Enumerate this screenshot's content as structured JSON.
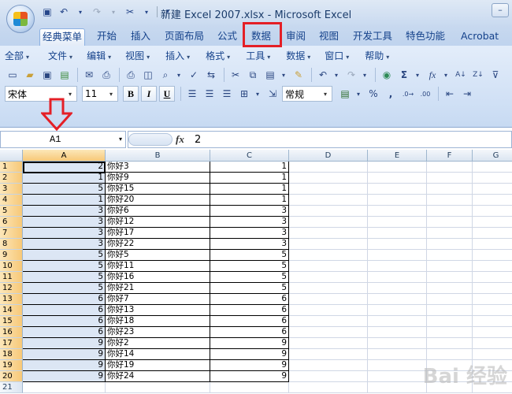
{
  "window": {
    "title": "新建 Excel 2007.xlsx - Microsoft Excel"
  },
  "quick_access": [
    "save-icon",
    "undo-icon",
    "redo-icon",
    "customize-icon"
  ],
  "ribbon_tabs": [
    {
      "label": "经典菜单",
      "active": true
    },
    {
      "label": "开始"
    },
    {
      "label": "插入"
    },
    {
      "label": "页面布局"
    },
    {
      "label": "公式"
    },
    {
      "label": "数据",
      "highlighted": true
    },
    {
      "label": "审阅"
    },
    {
      "label": "视图"
    },
    {
      "label": "开发工具"
    },
    {
      "label": "特色功能"
    },
    {
      "label": "Acrobat"
    }
  ],
  "menus": [
    "全部",
    "文件",
    "编辑",
    "视图",
    "插入",
    "格式",
    "工具",
    "数据",
    "窗口",
    "帮助"
  ],
  "format_bar": {
    "font": "宋体",
    "size": "11",
    "number_format": "常规",
    "bold": "B",
    "italic": "I",
    "underline": "U"
  },
  "formula_bar": {
    "name_box": "A1",
    "fx": "fx",
    "value": "2"
  },
  "columns": [
    "A",
    "B",
    "C",
    "D",
    "E",
    "F",
    "G"
  ],
  "rows": [
    {
      "n": "1",
      "a": "2",
      "b": "你好3",
      "c": "1"
    },
    {
      "n": "2",
      "a": "1",
      "b": "你好9",
      "c": "1"
    },
    {
      "n": "3",
      "a": "5",
      "b": "你好15",
      "c": "1"
    },
    {
      "n": "4",
      "a": "1",
      "b": "你好20",
      "c": "1"
    },
    {
      "n": "5",
      "a": "3",
      "b": "你好6",
      "c": "3"
    },
    {
      "n": "6",
      "a": "3",
      "b": "你好12",
      "c": "3"
    },
    {
      "n": "7",
      "a": "3",
      "b": "你好17",
      "c": "3"
    },
    {
      "n": "8",
      "a": "3",
      "b": "你好22",
      "c": "3"
    },
    {
      "n": "9",
      "a": "5",
      "b": "你好5",
      "c": "5"
    },
    {
      "n": "10",
      "a": "5",
      "b": "你好11",
      "c": "5"
    },
    {
      "n": "11",
      "a": "5",
      "b": "你好16",
      "c": "5"
    },
    {
      "n": "12",
      "a": "5",
      "b": "你好21",
      "c": "5"
    },
    {
      "n": "13",
      "a": "6",
      "b": "你好7",
      "c": "6"
    },
    {
      "n": "14",
      "a": "6",
      "b": "你好13",
      "c": "6"
    },
    {
      "n": "15",
      "a": "6",
      "b": "你好18",
      "c": "6"
    },
    {
      "n": "16",
      "a": "6",
      "b": "你好23",
      "c": "6"
    },
    {
      "n": "17",
      "a": "9",
      "b": "你好2",
      "c": "9"
    },
    {
      "n": "18",
      "a": "9",
      "b": "你好14",
      "c": "9"
    },
    {
      "n": "19",
      "a": "9",
      "b": "你好19",
      "c": "9"
    },
    {
      "n": "20",
      "a": "9",
      "b": "你好24",
      "c": "9"
    },
    {
      "n": "21",
      "a": "",
      "b": "",
      "c": ""
    }
  ],
  "watermark": "Bai 经验",
  "colors": {
    "highlight": "#e41f26",
    "selection": "#dce6f4"
  }
}
